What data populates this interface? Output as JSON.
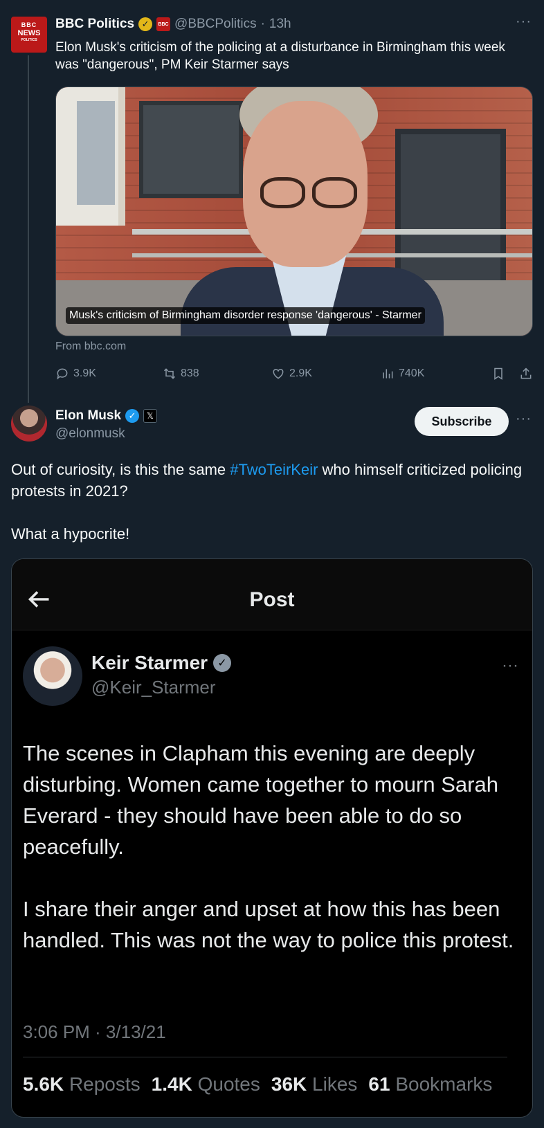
{
  "bbc_post": {
    "logo": {
      "line1": "BBC",
      "line2": "NEWS",
      "line3": "POLITICS"
    },
    "name": "BBC Politics",
    "handle": "@BBCPolitics",
    "separator": "·",
    "time": "13h",
    "more": "···",
    "text": "Elon Musk's criticism of the policing at a disturbance in Birmingham this week was \"dangerous\", PM Keir Starmer says",
    "media_caption": "Musk's criticism of Birmingham disorder response 'dangerous' - Starmer",
    "source": "From bbc.com",
    "actions": {
      "replies": "3.9K",
      "reposts": "838",
      "likes": "2.9K",
      "views": "740K"
    }
  },
  "musk_post": {
    "name": "Elon Musk",
    "handle": "@elonmusk",
    "subscribe_label": "Subscribe",
    "more": "···",
    "text_before": "Out of curiosity, is this the same ",
    "hashtag": "#TwoTeirKeir",
    "text_after": " who himself criticized policing protests in 2021?",
    "text_line2": "What a hypocrite!"
  },
  "embedded_post": {
    "header_title": "Post",
    "name": "Keir Starmer",
    "handle": "@Keir_Starmer",
    "more": "···",
    "paragraph1": "The scenes in Clapham this evening are deeply disturbing. Women came together to mourn Sarah Everard  - they should have been able to do so peacefully.",
    "paragraph2": "I share their anger and upset at how this has been handled. This was not the way to police this protest.",
    "timestamp": "3:06 PM · 3/13/21",
    "stats": [
      {
        "value": "5.6K",
        "label": "Reposts"
      },
      {
        "value": "1.4K",
        "label": "Quotes"
      },
      {
        "value": "36K",
        "label": "Likes"
      },
      {
        "value": "61",
        "label": "Bookmarks"
      }
    ]
  },
  "colors": {
    "background": "#15202b",
    "accent": "#1d9bf0",
    "bbc_red": "#bb1919",
    "gold_badge": "#e2b719"
  },
  "icons": [
    "reply-icon",
    "repost-icon",
    "like-icon",
    "views-icon",
    "bookmark-icon",
    "share-icon",
    "back-arrow-icon",
    "verified-icon"
  ]
}
